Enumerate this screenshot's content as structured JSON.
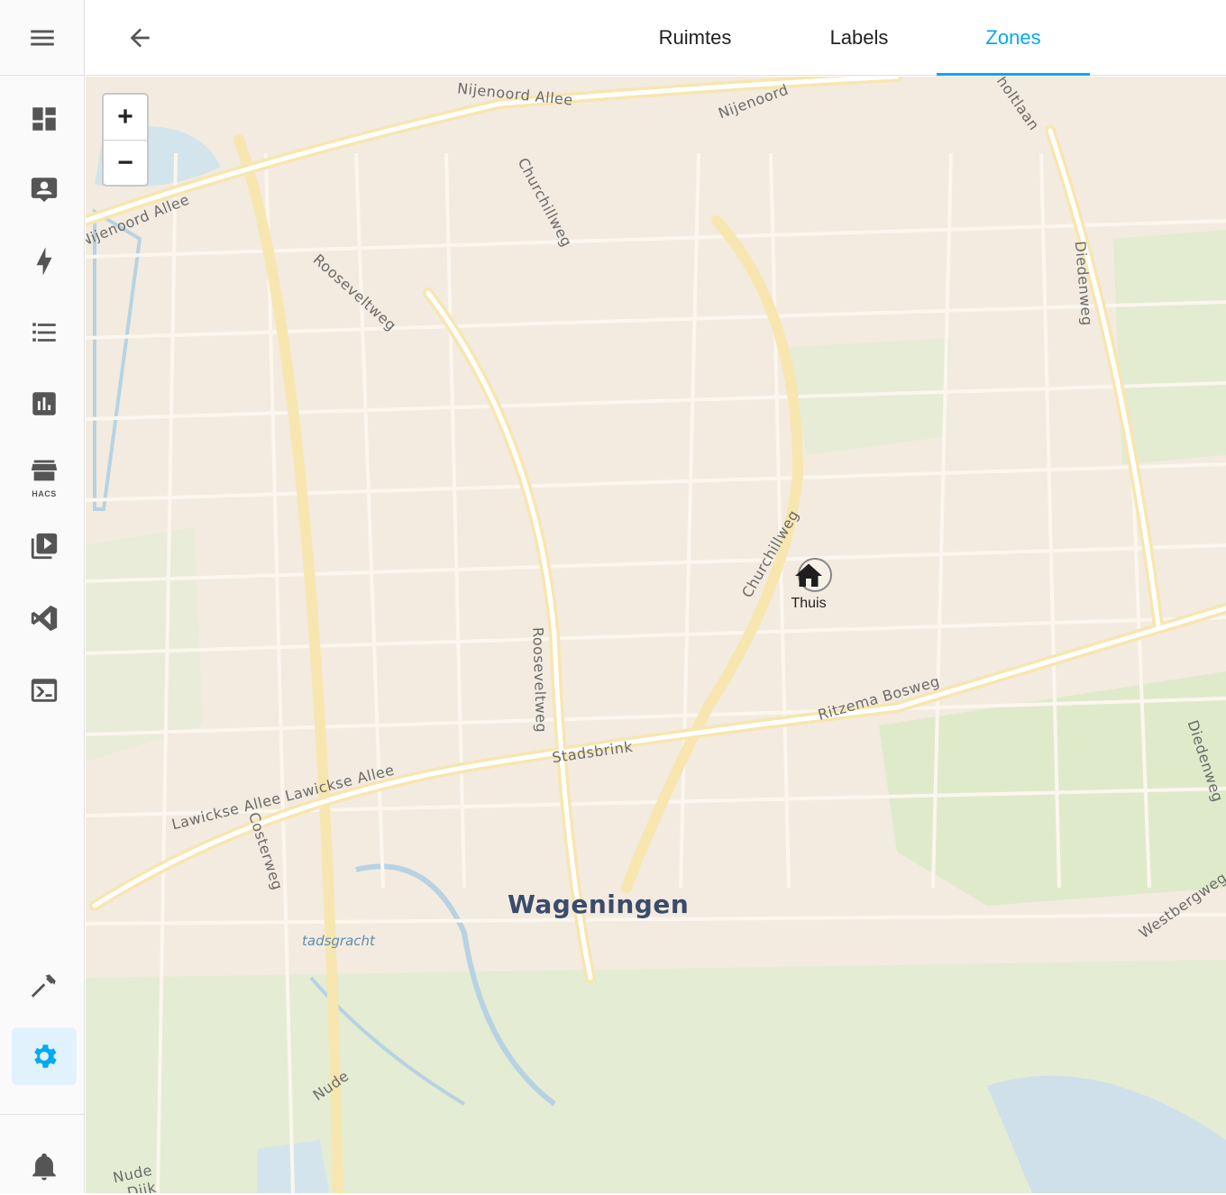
{
  "sidebar": {
    "items": [
      {
        "name": "dashboard",
        "icon": "view-dashboard-icon"
      },
      {
        "name": "map",
        "icon": "account-box-icon"
      },
      {
        "name": "energy",
        "icon": "lightning-bolt-icon"
      },
      {
        "name": "logbook",
        "icon": "format-list-bulleted-icon"
      },
      {
        "name": "history",
        "icon": "chart-box-icon"
      },
      {
        "name": "hacs",
        "icon": "store-icon",
        "label": "HACS"
      },
      {
        "name": "media",
        "icon": "play-box-multiple-icon"
      },
      {
        "name": "vscode",
        "icon": "microsoft-visual-studio-code-icon"
      },
      {
        "name": "terminal",
        "icon": "console-icon"
      },
      {
        "name": "developer-tools",
        "icon": "hammer-icon"
      },
      {
        "name": "settings",
        "icon": "cog-icon",
        "active": true
      },
      {
        "name": "notifications",
        "icon": "bell-icon"
      }
    ],
    "accent": "#03a9f4"
  },
  "header": {
    "tabs": [
      {
        "label": "Ruimtes",
        "active": false
      },
      {
        "label": "Labels",
        "active": false
      },
      {
        "label": "Zones",
        "active": true
      }
    ]
  },
  "map": {
    "zoom_in": "+",
    "zoom_out": "−",
    "labels": {
      "nijenoord_allee_top": "Nijenoord Allee",
      "nijenoord_right": "Nijenoord",
      "nijenoord_allee_left": "Nijenoord Allee",
      "churchillweg_top": "Churchillweg",
      "rooseveltweg_top": "Rooseveltweg",
      "rooseveltweg_mid": "Rooseveltweg",
      "churchillweg_mid": "Churchillweg",
      "diedenweg_top": "Diedenweg",
      "diedenweg_bottom": "Diedenweg",
      "holtlaan": "holtlaan",
      "ritzema_bosweg": "Ritzema Bosweg",
      "stadsbrink": "Stadsbrink",
      "lawickse_allee": "Lawickse Allee Lawickse Allee",
      "costerweg": "Costerweg",
      "westbergweg": "Westbergweg",
      "nude": "Nude",
      "nude_bottom": "Nude",
      "nude_bottom2": "Dijk"
    },
    "city": "Wageningen",
    "water": "tadsgracht",
    "zone": {
      "name": "Thuis",
      "icon": "home-icon"
    }
  }
}
